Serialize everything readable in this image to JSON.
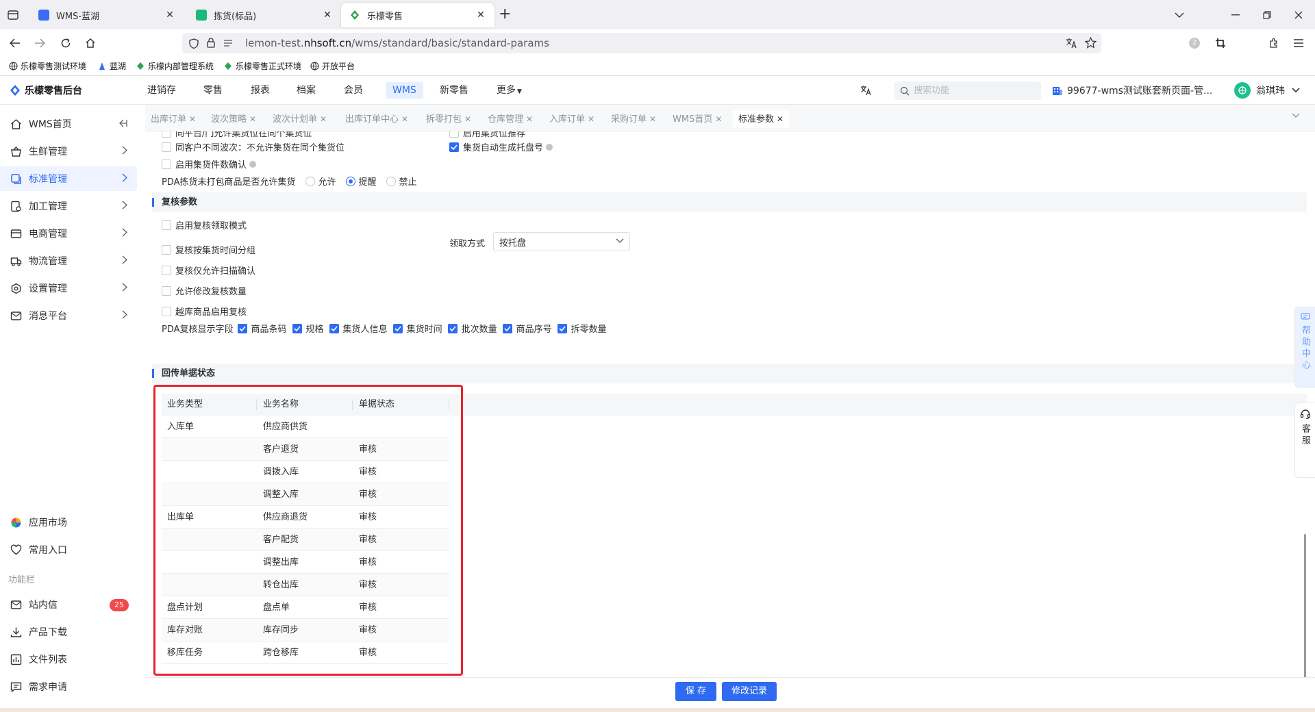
{
  "browser": {
    "tabs": [
      {
        "title": "WMS-蓝湖",
        "active": false,
        "favicon_color": "#3b6cf6"
      },
      {
        "title": "拣货(标品)",
        "active": false,
        "favicon_color": "#19b97a"
      },
      {
        "title": "乐檬零售",
        "active": true,
        "favicon_color": "#2ea44f"
      }
    ],
    "url_prefix": "lemon-test.",
    "url_domain": "nhsoft.cn",
    "url_path": "/wms/standard/basic/standard-params",
    "bookmarks": [
      "乐檬零售测试环境",
      "蓝湖",
      "乐檬内部管理系统",
      "乐檬零售正式环境",
      "开放平台"
    ],
    "extension_badge": "2"
  },
  "header": {
    "logo_text": "乐檬零售后台",
    "nav": [
      "进销存",
      "零售",
      "报表",
      "档案",
      "会员",
      "WMS",
      "新零售",
      "更多"
    ],
    "active_nav": "WMS",
    "search_placeholder": "搜索功能",
    "account_label": "99677-wms测试账套新页面-管...",
    "user_name": "翁琪玮"
  },
  "sidebar": {
    "menu": [
      "WMS首页",
      "生鲜管理",
      "标准管理",
      "加工管理",
      "电商管理",
      "物流管理",
      "设置管理",
      "消息平台"
    ],
    "active": "标准管理",
    "bottom": [
      "应用市场",
      "常用入口"
    ],
    "section_label": "功能栏",
    "tools": [
      "站内信",
      "产品下载",
      "文件列表",
      "需求申请"
    ],
    "inbox_badge": "25"
  },
  "page_tabs": [
    "出库订单",
    "波次策略",
    "波次计划单",
    "出库订单中心",
    "拆零打包",
    "仓库管理",
    "入库订单",
    "采购订单",
    "WMS首页",
    "标准参数"
  ],
  "active_page_tab": "标准参数",
  "settings": {
    "partial_top_left": "同平台/门允许集货位在同个集货位",
    "partial_top_right": "启用集货位推荐",
    "different_wave": "同客户不同波次：不允许集货在同个集货位",
    "auto_pallet": "集货自动生成托盘号",
    "confirm_count": "启用集货件数确认",
    "pda_unpacked_label": "PDA拣货未打包商品是否允许集货",
    "pda_unpacked_options": [
      "允许",
      "提醒",
      "禁止"
    ],
    "pda_unpacked_selected": "提醒"
  },
  "review": {
    "section_title": "复核参数",
    "options": [
      "启用复核领取模式",
      "复核按集货时间分组",
      "复核仅允许扫描确认",
      "允许修改复核数量",
      "越库商品启用复核"
    ],
    "claim_label": "领取方式",
    "claim_value": "按托盘",
    "pda_fields_label": "PDA复核显示字段",
    "pda_fields": [
      "商品条码",
      "规格",
      "集货人信息",
      "集货时间",
      "批次数量",
      "商品序号",
      "拆零数量"
    ]
  },
  "return_status": {
    "section_title": "回传单据状态",
    "columns": [
      "业务类型",
      "业务名称",
      "单据状态"
    ],
    "rows": [
      {
        "type": "入库单",
        "name": "供应商供货",
        "status": ""
      },
      {
        "type": "",
        "name": "客户退货",
        "status": "审核"
      },
      {
        "type": "",
        "name": "调拨入库",
        "status": "审核"
      },
      {
        "type": "",
        "name": "调整入库",
        "status": "审核"
      },
      {
        "type": "出库单",
        "name": "供应商退货",
        "status": "审核"
      },
      {
        "type": "",
        "name": "客户配货",
        "status": "审核"
      },
      {
        "type": "",
        "name": "调整出库",
        "status": "审核"
      },
      {
        "type": "",
        "name": "转仓出库",
        "status": "审核"
      },
      {
        "type": "盘点计划",
        "name": "盘点单",
        "status": "审核"
      },
      {
        "type": "库存对账",
        "name": "库存同步",
        "status": "审核"
      },
      {
        "type": "移库任务",
        "name": "跨仓移库",
        "status": "审核"
      }
    ]
  },
  "actions": {
    "save": "保 存",
    "history": "修改记录"
  },
  "float_help": "帮助中心",
  "float_service": "客服",
  "colors": {
    "primary": "#2f6bf2",
    "highlight": "#e8232f",
    "badge": "#f04a4a"
  }
}
